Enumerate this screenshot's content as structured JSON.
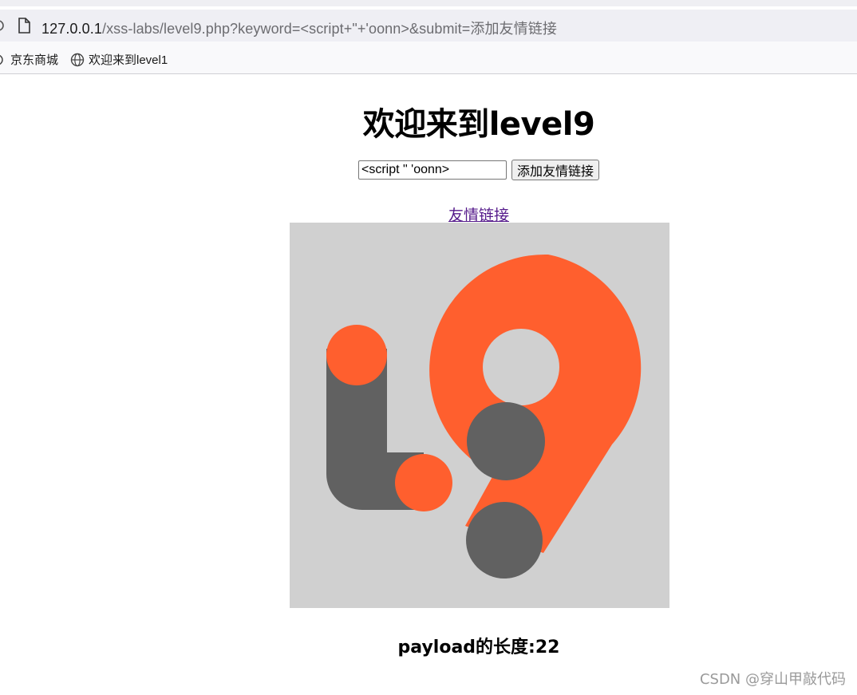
{
  "browser": {
    "url_host": "127.0.0.1",
    "url_rest": "/xss-labs/level9.php?keyword=<script+\"+'oonn>&submit=添加友情链接"
  },
  "bookmarks": [
    {
      "label": "京东商城"
    },
    {
      "label": "欢迎来到level1"
    }
  ],
  "page": {
    "heading": "欢迎来到level9",
    "keyword_value": "<script \" 'oonn>",
    "submit_label": "添加友情链接",
    "link_text": "友情链接",
    "payload_text": "payload的长度:22"
  },
  "logo": {
    "background": "#d0d0d0",
    "orange": "#ff5f2e",
    "gray": "#616161"
  },
  "watermark": "CSDN @穿山甲敲代码"
}
